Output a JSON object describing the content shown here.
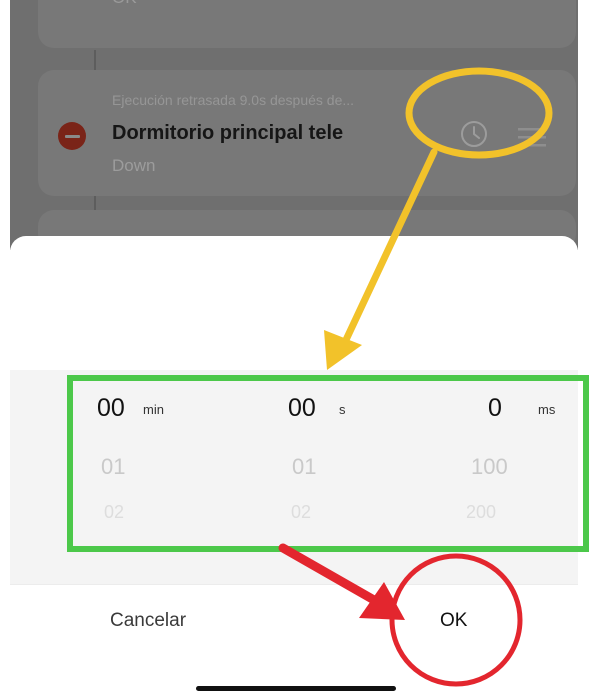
{
  "background_list": {
    "top_card_text": "OK",
    "item": {
      "delay_text": "Ejecución retrasada 9.0s después de...",
      "device_name": "Dormitorio principal tele",
      "action": "Down"
    }
  },
  "picker": {
    "columns": [
      {
        "selected": "00",
        "unit": "min",
        "next": "01",
        "after": "02"
      },
      {
        "selected": "00",
        "unit": "s",
        "next": "01",
        "after": "02"
      },
      {
        "selected": "0",
        "unit": "ms",
        "next": "100",
        "after": "200"
      }
    ]
  },
  "buttons": {
    "cancel": "Cancelar",
    "ok": "OK"
  },
  "annotation_colors": {
    "highlight_yellow": "#f2c22a",
    "picker_box_green": "#4cc84a",
    "ok_circle_red": "#e3262e"
  },
  "icons": [
    "remove-icon",
    "clock-icon",
    "drag-handle-icon"
  ]
}
